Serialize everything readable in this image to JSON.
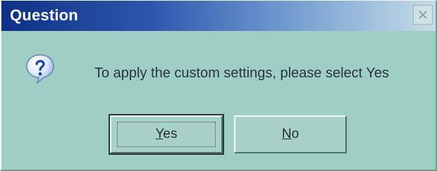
{
  "dialog": {
    "title": "Question",
    "close_icon": "close-icon",
    "message_icon": "question-icon",
    "message": "To apply the custom settings, please select Yes",
    "buttons": {
      "yes": {
        "mnemonic": "Y",
        "rest": "es"
      },
      "no": {
        "mnemonic": "N",
        "rest": "o"
      }
    }
  }
}
